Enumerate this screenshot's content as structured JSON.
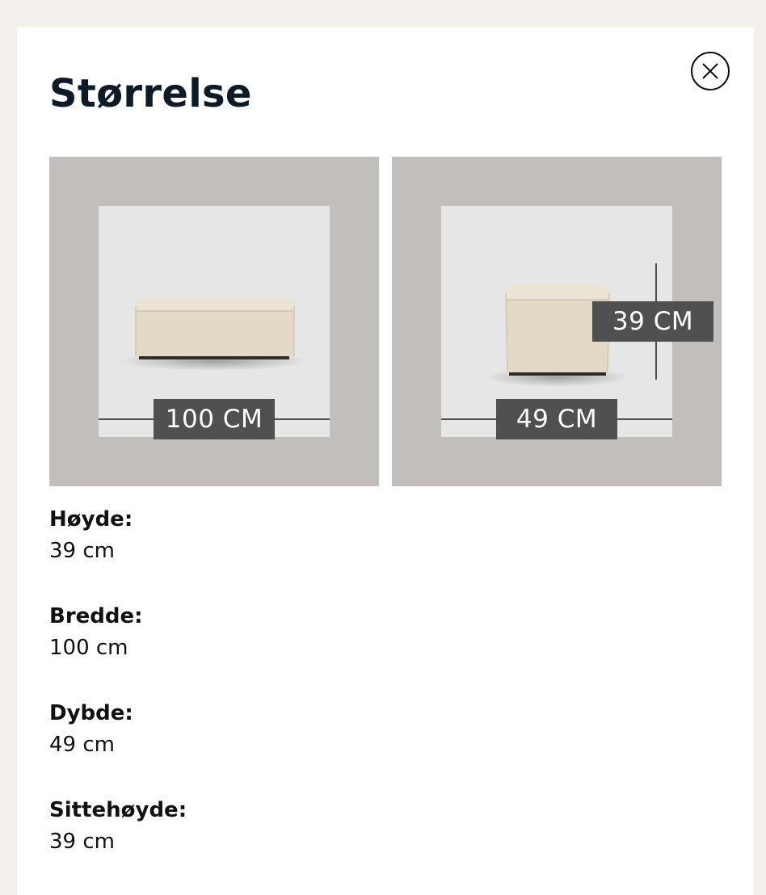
{
  "modal": {
    "title": "Størrelse",
    "close_icon": "close-icon"
  },
  "images": {
    "front": {
      "width_label": "100 CM"
    },
    "side": {
      "depth_label": "49 CM",
      "height_label": "39 CM"
    }
  },
  "specs": [
    {
      "label": "Høyde:",
      "value": "39 cm"
    },
    {
      "label": "Bredde:",
      "value": "100 cm"
    },
    {
      "label": "Dybde:",
      "value": "49 cm"
    },
    {
      "label": "Sittehøyde:",
      "value": "39 cm"
    }
  ],
  "colors": {
    "page_bg": "#f4f0ec",
    "panel_bg": "#c2bebc",
    "photo_bg": "#e6e6e6",
    "label_bg": "#505050",
    "product": "#e4dccb"
  }
}
